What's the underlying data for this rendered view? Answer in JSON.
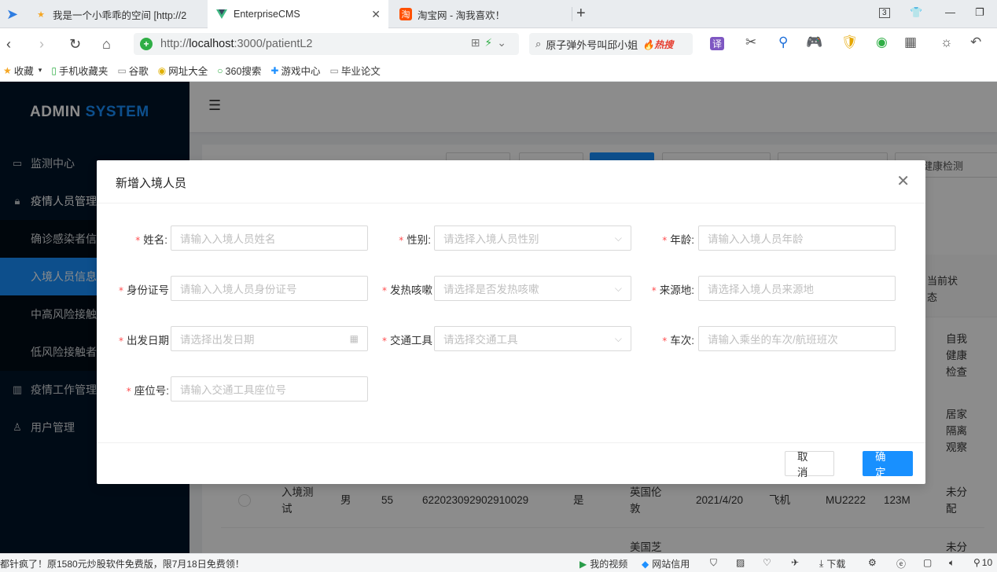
{
  "browser": {
    "tabs": [
      {
        "title": "我是一个小乖乖的空间 [http://2",
        "icon": "star-icon",
        "active": false
      },
      {
        "title": "EnterpriseCMS",
        "icon": "vue-logo-icon",
        "active": true
      },
      {
        "title": "淘宝网 - 淘我喜欢！",
        "icon": "taobao-icon",
        "active": false
      }
    ],
    "tab_count_badge": "3",
    "url_host": "localhost",
    "url_rest": ":3000/patientL2",
    "url_prefix": "http://",
    "search_text": "原子弹外号叫邱小姐",
    "search_hot": "热搜",
    "translate_label": "译",
    "bookmarks": [
      {
        "label": "收藏",
        "icon": "star-icon"
      },
      {
        "label": "手机收藏夹",
        "icon": "phone-icon"
      },
      {
        "label": "谷歌",
        "icon": "page-icon"
      },
      {
        "label": "网址大全",
        "icon": "globe-icon"
      },
      {
        "label": "360搜索",
        "icon": "search-360-icon"
      },
      {
        "label": "游戏中心",
        "icon": "game-icon"
      },
      {
        "label": "毕业论文",
        "icon": "page-icon"
      }
    ]
  },
  "app": {
    "logo_admin": "ADMIN",
    "logo_system": "SYSTEM",
    "menu": [
      {
        "label": "监测中心",
        "icon": "monitor-icon",
        "type": "top"
      },
      {
        "label": "疫情人员管理",
        "icon": "lock-icon",
        "type": "top"
      },
      {
        "label": "确诊感染者信息",
        "type": "sub"
      },
      {
        "label": "入境人员信息",
        "type": "sub",
        "selected": true
      },
      {
        "label": "中高风险接触者",
        "type": "sub"
      },
      {
        "label": "低风险接触者",
        "type": "sub"
      },
      {
        "label": "疫情工作管理",
        "icon": "table-icon",
        "type": "top"
      },
      {
        "label": "用户管理",
        "icon": "user-icon",
        "type": "top"
      }
    ],
    "toolbar_last_button": "自我健康检测",
    "table": {
      "state_header": "当前状态",
      "state_values": [
        "自我健康检查",
        "居家隔离观察"
      ],
      "visible_row": {
        "name": "入境测试",
        "gender": "男",
        "age": "55",
        "id_number": "622023092902910029",
        "fever": "是",
        "origin": "英国伦敦",
        "date": "2021/4/20",
        "transport": "飞机",
        "trip": "MU2222",
        "seat": "123M",
        "state": "未分配"
      },
      "partial_row": {
        "origin": "美国芝",
        "state": "未分"
      }
    }
  },
  "modal": {
    "title": "新增入境人员",
    "cancel_label": "取 消",
    "ok_label": "确 定",
    "fields": [
      {
        "label": "姓名:",
        "placeholder": "请输入入境人员姓名",
        "kind": "input"
      },
      {
        "label": "性别:",
        "placeholder": "请选择入境人员性别",
        "kind": "select"
      },
      {
        "label": "年龄:",
        "placeholder": "请输入入境人员年龄",
        "kind": "input"
      },
      {
        "label": "身份证号",
        "placeholder": "请输入入境人员身份证号",
        "kind": "input"
      },
      {
        "label": "发热咳嗽",
        "placeholder": "请选择是否发热咳嗽",
        "kind": "select"
      },
      {
        "label": "来源地:",
        "placeholder": "请选择入境人员来源地",
        "kind": "input"
      },
      {
        "label": "出发日期",
        "placeholder": "请选择出发日期",
        "kind": "date"
      },
      {
        "label": "交通工具",
        "placeholder": "请选择交通工具",
        "kind": "select"
      },
      {
        "label": "车次:",
        "placeholder": "请输入乘坐的车次/航班班次",
        "kind": "input"
      },
      {
        "label": "座位号:",
        "placeholder": "请输入交通工具座位号",
        "kind": "input"
      }
    ]
  },
  "statusbar": {
    "ad_text": "都针疯了！原1580元炒股软件免费版，限7月18日免费领！",
    "my_video": "我的视频",
    "credit": "网站信用",
    "download": "下载",
    "zoom_prefix": "10"
  }
}
